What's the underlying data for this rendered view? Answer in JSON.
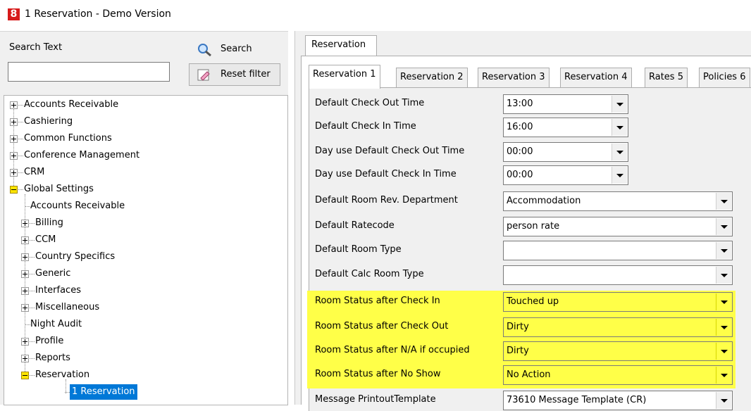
{
  "window": {
    "icon": "8",
    "title": "1 Reservation - Demo Version"
  },
  "left": {
    "search_label": "Search Text",
    "search_value": "",
    "search_button": "Search",
    "reset_button": "Reset filter"
  },
  "tree": [
    {
      "label": "Accounts Receivable",
      "level": 0,
      "state": "collapsed"
    },
    {
      "label": "Cashiering",
      "level": 0,
      "state": "collapsed"
    },
    {
      "label": "Common Functions",
      "level": 0,
      "state": "collapsed"
    },
    {
      "label": "Conference Management",
      "level": 0,
      "state": "collapsed"
    },
    {
      "label": "CRM",
      "level": 0,
      "state": "collapsed"
    },
    {
      "label": "Global Settings",
      "level": 0,
      "state": "expanded"
    },
    {
      "label": "Accounts Receivable",
      "level": 1,
      "state": "leaf"
    },
    {
      "label": "Billing",
      "level": 1,
      "state": "collapsed"
    },
    {
      "label": "CCM",
      "level": 1,
      "state": "collapsed"
    },
    {
      "label": "Country Specifics",
      "level": 1,
      "state": "collapsed"
    },
    {
      "label": "Generic",
      "level": 1,
      "state": "collapsed"
    },
    {
      "label": "Interfaces",
      "level": 1,
      "state": "collapsed"
    },
    {
      "label": "Miscellaneous",
      "level": 1,
      "state": "collapsed"
    },
    {
      "label": "Night Audit",
      "level": 1,
      "state": "leaf"
    },
    {
      "label": "Profile",
      "level": 1,
      "state": "collapsed"
    },
    {
      "label": "Reports",
      "level": 1,
      "state": "collapsed"
    },
    {
      "label": "Reservation",
      "level": 1,
      "state": "expanded"
    },
    {
      "label": "1 Reservation",
      "level": 2,
      "state": "selected"
    }
  ],
  "tabs": {
    "outer": "Reservation",
    "inner": [
      {
        "label": "Reservation 1",
        "active": true
      },
      {
        "label": "Reservation 2",
        "active": false
      },
      {
        "label": "Reservation 3",
        "active": false
      },
      {
        "label": "Reservation 4",
        "active": false
      },
      {
        "label": "Rates 5",
        "active": false
      },
      {
        "label": "Policies 6",
        "active": false
      }
    ]
  },
  "fields": [
    {
      "label": "Default Check Out Time",
      "value": "13:00",
      "highlight": false
    },
    {
      "label": "Default Check In Time",
      "value": "16:00",
      "highlight": false
    },
    {
      "label": "Day use Default Check Out Time",
      "value": "00:00",
      "highlight": false
    },
    {
      "label": "Day use Default Check In Time",
      "value": "00:00",
      "highlight": false
    },
    {
      "label": "Default Room Rev. Department",
      "value": "Accommodation",
      "highlight": false
    },
    {
      "label": "Default Ratecode",
      "value": "person rate",
      "highlight": false
    },
    {
      "label": "Default Room Type",
      "value": "",
      "highlight": false
    },
    {
      "label": "Default Calc Room Type",
      "value": "",
      "highlight": false
    },
    {
      "label": "Room Status after Check In",
      "value": "Touched up",
      "highlight": true
    },
    {
      "label": "Room Status after Check Out",
      "value": "Dirty",
      "highlight": true
    },
    {
      "label": "Room Status after N/A if occupied",
      "value": "Dirty",
      "highlight": true
    },
    {
      "label": "Room Status after No Show",
      "value": "No Action",
      "highlight": true
    },
    {
      "label": "Message PrintoutTemplate",
      "value": "73610 Message Template (CR)",
      "highlight": false
    }
  ],
  "colors": {
    "highlight": "#ffff48",
    "selection": "#0078d7",
    "app_icon": "#d71a1a"
  }
}
